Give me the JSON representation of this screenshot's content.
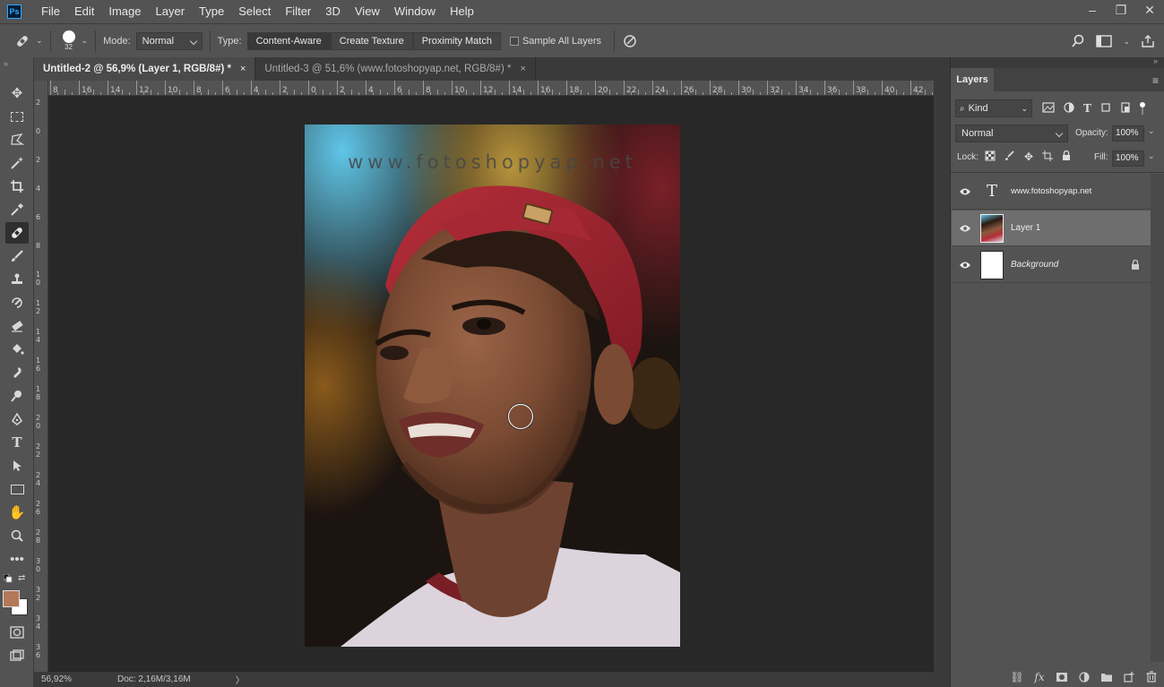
{
  "app": {
    "logo": "Ps"
  },
  "menu": [
    "File",
    "Edit",
    "Image",
    "Layer",
    "Type",
    "Select",
    "Filter",
    "3D",
    "View",
    "Window",
    "Help"
  ],
  "window_controls": {
    "minimize": "–",
    "restore": "❐",
    "close": "✕"
  },
  "options": {
    "brush_size": "32",
    "mode_label": "Mode:",
    "mode_value": "Normal",
    "type_label": "Type:",
    "type_buttons": [
      "Content-Aware",
      "Create Texture",
      "Proximity Match"
    ],
    "sample_all_layers": "Sample All Layers"
  },
  "tabs": [
    {
      "label": "Untitled-2 @ 56,9% (Layer 1, RGB/8#) *",
      "close": "×"
    },
    {
      "label": "Untitled-3 @ 51,6% (www.fotoshopyap.net, RGB/8#) *",
      "close": "×"
    }
  ],
  "ruler": {
    "h_labels": [
      "8",
      "16",
      "14",
      "12",
      "10",
      "8",
      "6",
      "4",
      "2",
      "0",
      "2",
      "4",
      "6",
      "8",
      "10",
      "12",
      "14",
      "16",
      "18",
      "20",
      "22",
      "24",
      "26",
      "28",
      "30",
      "32",
      "34",
      "36",
      "38",
      "40",
      "42"
    ],
    "v_labels": [
      "2",
      "0",
      "2",
      "4",
      "6",
      "8",
      "10",
      "12",
      "14",
      "16",
      "18",
      "20",
      "22",
      "24",
      "26",
      "28",
      "30",
      "32",
      "34",
      "36"
    ]
  },
  "canvas": {
    "watermark": "www.fotoshopyap.net"
  },
  "status": {
    "zoom": "56,92%",
    "doc": "Doc: 2,16M/3,16M",
    "arrow": "〉"
  },
  "panel": {
    "tab": "Layers",
    "filter_kind": "Kind",
    "blend_mode": "Normal",
    "opacity_label": "Opacity:",
    "opacity_value": "100%",
    "lock_label": "Lock:",
    "fill_label": "Fill:",
    "fill_value": "100%",
    "layers": [
      {
        "name": "www.fotoshopyap.net",
        "type": "text"
      },
      {
        "name": "Layer 1",
        "type": "image"
      },
      {
        "name": "Background",
        "type": "background"
      }
    ],
    "text_layer_glyph": "T"
  },
  "colors": {
    "foreground": "#b4785a",
    "background": "#ffffff",
    "ui_dark": "#282828",
    "ui_panel": "#535353"
  }
}
